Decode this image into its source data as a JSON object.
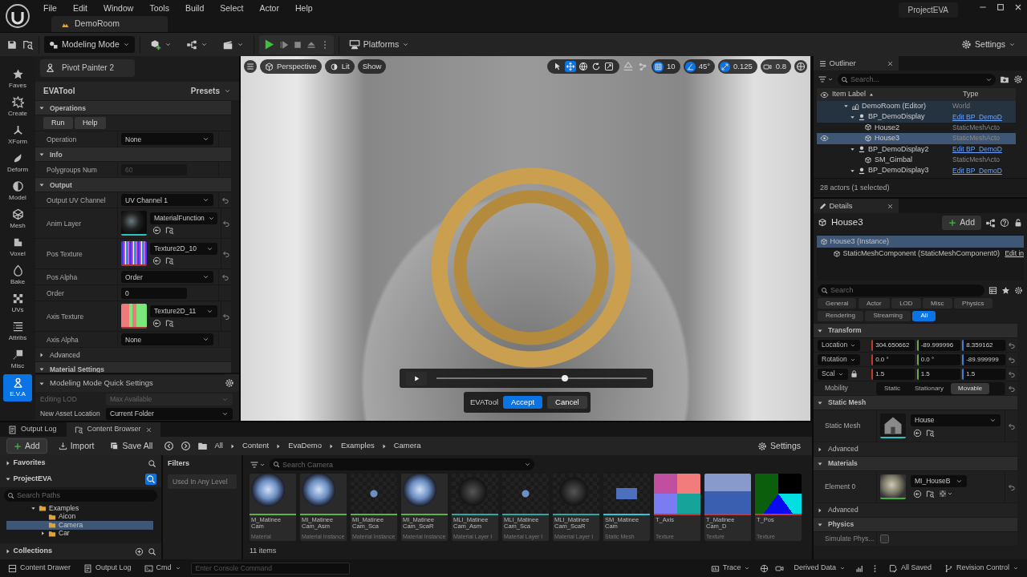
{
  "menu": [
    "File",
    "Edit",
    "Window",
    "Tools",
    "Build",
    "Select",
    "Actor",
    "Help"
  ],
  "project": "ProjectEVA",
  "level_tab": "DemoRoom",
  "toolbar": {
    "mode": "Modeling Mode",
    "platforms": "Platforms",
    "settings": "Settings"
  },
  "mode_palette": [
    {
      "label": "Faves",
      "kind": "star",
      "selected": false
    },
    {
      "label": "Create",
      "kind": "create",
      "selected": false
    },
    {
      "label": "XForm",
      "kind": "xform",
      "selected": false
    },
    {
      "label": "Deform",
      "kind": "deform",
      "selected": false
    },
    {
      "label": "Model",
      "kind": "model",
      "selected": false
    },
    {
      "label": "Mesh",
      "kind": "mesh",
      "selected": false
    },
    {
      "label": "Voxel",
      "kind": "voxel",
      "selected": false
    },
    {
      "label": "Bake",
      "kind": "bake",
      "selected": false
    },
    {
      "label": "UVs",
      "kind": "uvs",
      "selected": false
    },
    {
      "label": "Attribs",
      "kind": "attribs",
      "selected": false
    },
    {
      "label": "Misc",
      "kind": "misc",
      "selected": false
    },
    {
      "label": "E.V.A",
      "kind": "eva",
      "selected": true
    }
  ],
  "tool_panel": {
    "preset_button": "Pivot Painter 2",
    "title": "EVATool",
    "presets": "Presets",
    "sections": [
      {
        "title": "Operations",
        "kind": "category",
        "expanded": true,
        "rows": [
          {
            "kind": "buttons",
            "buttons": [
              "Run",
              "Help"
            ]
          },
          {
            "kind": "dropdown",
            "label": "Operation",
            "value": "None",
            "resettable": false
          }
        ]
      },
      {
        "title": "Info",
        "kind": "category",
        "expanded": true,
        "rows": [
          {
            "kind": "number",
            "label": "Polygroups Num",
            "value": "60",
            "disabled": true
          }
        ]
      },
      {
        "title": "Output",
        "kind": "category",
        "expanded": true,
        "rows": [
          {
            "kind": "dropdown",
            "label": "Output UV Channel",
            "value": "UV Channel 1",
            "resettable": true
          },
          {
            "kind": "asset",
            "label": "Anim Layer",
            "value": "MaterialFunction",
            "resettable": true
          },
          {
            "kind": "asset",
            "label": "Pos Texture",
            "value": "Texture2D_10",
            "resettable": true
          },
          {
            "kind": "dropdown",
            "label": "Pos Alpha",
            "value": "Order",
            "resettable": true
          },
          {
            "kind": "number",
            "label": "Order",
            "value": "0",
            "disabled": false
          },
          {
            "kind": "asset",
            "label": "Axis Texture",
            "value": "Texture2D_11",
            "resettable": true
          },
          {
            "kind": "dropdown",
            "label": "Axis Alpha",
            "value": "None",
            "resettable": false
          }
        ]
      },
      {
        "title": "Advanced",
        "kind": "group",
        "expanded": false
      },
      {
        "title": "Material Settings",
        "kind": "category",
        "expanded": true
      }
    ]
  },
  "quick_settings": {
    "title": "Modeling Mode Quick Settings",
    "rows": [
      {
        "label": "Editing LOD",
        "value": "Max Available",
        "disabled": true
      },
      {
        "label": "New Asset Location",
        "value": "Current Folder",
        "disabled": false
      }
    ]
  },
  "viewport": {
    "view_mode": "Perspective",
    "lighting": "Lit",
    "show": "Show",
    "transform_tools": [
      {
        "kind": "select",
        "selected": false
      },
      {
        "kind": "move",
        "selected": true
      },
      {
        "kind": "world",
        "selected": false
      },
      {
        "kind": "rotate",
        "selected": false
      },
      {
        "kind": "scale",
        "selected": false
      }
    ],
    "snaps": [
      {
        "kind": "grid",
        "value": "10",
        "on": true
      },
      {
        "kind": "angle",
        "value": "45°",
        "on": true
      },
      {
        "kind": "scale",
        "value": "0.125",
        "on": true
      },
      {
        "kind": "camera",
        "value": "0.8",
        "on": false
      }
    ],
    "playback": {
      "level": 0.61
    },
    "tool_overlay": {
      "label": "EVATool",
      "accept": "Accept",
      "cancel": "Cancel"
    }
  },
  "outliner": {
    "title": "Outliner",
    "search_placeholder": "Search...",
    "columns": [
      "Item Label",
      "Type"
    ],
    "items": [
      {
        "label": "DemoRoom (Editor)",
        "kind": "world",
        "type": "World",
        "type_link": false,
        "selected": false,
        "eye": false,
        "expanded": true,
        "children": [
          {
            "label": "BP_DemoDisplay",
            "kind": "blueprint",
            "type": "Edit BP_DemoD",
            "type_link": true,
            "selected": false,
            "eye": false,
            "expanded": true,
            "children": [
              {
                "label": "House2",
                "kind": "mesh",
                "type": "StaticMeshActo",
                "type_link": false,
                "selected": false,
                "eye": false
              },
              {
                "label": "House3",
                "kind": "mesh",
                "type": "StaticMeshActo",
                "type_link": false,
                "selected": true,
                "eye": true
              }
            ]
          },
          {
            "label": "BP_DemoDisplay2",
            "kind": "blueprint",
            "type": "Edit BP_DemoD",
            "type_link": true,
            "selected": false,
            "eye": false,
            "expanded": true,
            "children": [
              {
                "label": "SM_Gimbal",
                "kind": "mesh",
                "type": "StaticMeshActo",
                "type_link": false,
                "selected": false,
                "eye": false
              }
            ]
          },
          {
            "label": "BP_DemoDisplay3",
            "kind": "blueprint",
            "type": "Edit BP_DemoD",
            "type_link": true,
            "selected": false,
            "eye": false,
            "expanded": true
          }
        ]
      }
    ],
    "footer": "28 actors (1 selected)"
  },
  "details": {
    "title": "Details",
    "actor": "House3",
    "add": "Add",
    "components": [
      {
        "label": "House3 (Instance)",
        "selected": true
      },
      {
        "label": "StaticMeshComponent (StaticMeshComponent0)",
        "selected": false,
        "link": "Edit in"
      }
    ],
    "search_placeholder": "Search",
    "filters": [
      {
        "label": "General",
        "selected": false
      },
      {
        "label": "Actor",
        "selected": false
      },
      {
        "label": "LOD",
        "selected": false
      },
      {
        "label": "Misc",
        "selected": false
      },
      {
        "label": "Physics",
        "selected": false
      },
      {
        "label": "Rendering",
        "selected": false
      },
      {
        "label": "Streaming",
        "selected": false
      },
      {
        "label": "All",
        "selected": true
      }
    ],
    "sections": [
      {
        "title": "Transform",
        "kind": "category",
        "expanded": true,
        "rows": [
          {
            "kind": "vector",
            "label": "Location",
            "values": [
              "304.650662",
              "-89.999996",
              "8.359162"
            ],
            "locked": false
          },
          {
            "kind": "vector",
            "label": "Rotation",
            "values": [
              "0.0 °",
              "0.0 °",
              "-89.999999"
            ],
            "locked": false
          },
          {
            "kind": "vector",
            "label": "Scal",
            "values": [
              "1.5",
              "1.5",
              "1.5"
            ],
            "locked": true
          },
          {
            "kind": "segmented",
            "label": "Mobility",
            "options": [
              {
                "label": "Static",
                "selected": false
              },
              {
                "label": "Stationary",
                "selected": false
              },
              {
                "label": "Movable",
                "selected": true
              }
            ]
          }
        ]
      },
      {
        "title": "Static Mesh",
        "kind": "category",
        "expanded": true,
        "rows": [
          {
            "kind": "asset",
            "label": "Static Mesh",
            "value": "House",
            "material_options": false
          }
        ]
      },
      {
        "title": "Advanced",
        "kind": "group",
        "expanded": false
      },
      {
        "title": "Materials",
        "kind": "category",
        "expanded": true,
        "rows": [
          {
            "kind": "asset",
            "label": "Element 0",
            "value": "MI_HouseB",
            "material_options": true
          }
        ]
      },
      {
        "title": "Advanced",
        "kind": "group",
        "expanded": false
      },
      {
        "title": "Physics",
        "kind": "category",
        "expanded": true,
        "rows": [
          {
            "kind": "checkbox",
            "label": "Simulate Phys...",
            "checked": false,
            "disabled": true
          }
        ]
      }
    ]
  },
  "bottom_tabs": [
    {
      "label": "Output Log",
      "selected": false
    },
    {
      "label": "Content Browser",
      "selected": true
    }
  ],
  "content_browser": {
    "add": "Add",
    "import": "Import",
    "save_all": "Save All",
    "path": [
      "All",
      "Content",
      "EvaDemo",
      "Examples",
      "Camera"
    ],
    "settings": "Settings",
    "favorites": {
      "label": "Favorites",
      "expanded": false
    },
    "project": {
      "label": "ProjectEVA",
      "expanded": true
    },
    "path_search_placeholder": "Search Paths",
    "folders": [
      {
        "label": "Examples",
        "selected": false,
        "expanded": true,
        "children": [
          {
            "label": "Aicon",
            "selected": false
          },
          {
            "label": "Camera",
            "selected": true
          },
          {
            "label": "Car",
            "selected": false,
            "expanded": false
          }
        ]
      }
    ],
    "collections": {
      "label": "Collections",
      "expanded": false
    },
    "filters_title": "Filters",
    "filter_chips": [
      "Used In Any Level"
    ],
    "search_placeholder": "Search Camera",
    "assets": [
      {
        "name": "M_Matinee Cam",
        "type": "Material",
        "kind": "sphere",
        "color": "#5fb24a"
      },
      {
        "name": "MI_Matinee Cam_Asm",
        "type": "Material Instance",
        "kind": "sphere",
        "color": "#5fb24a"
      },
      {
        "name": "MI_Matinee Cam_Sca",
        "type": "Material Instance",
        "kind": "small",
        "color": "#5fb24a"
      },
      {
        "name": "MI_Matinee Cam_ScaR",
        "type": "Material Instance",
        "kind": "sphere",
        "color": "#5fb24a"
      },
      {
        "name": "MLI_Matinee Cam_Asm",
        "type": "Material Layer I",
        "kind": "dark",
        "color": "#2fa7a2"
      },
      {
        "name": "MLI_Matinee Cam_Sca",
        "type": "Material Layer I",
        "kind": "small",
        "color": "#2fa7a2"
      },
      {
        "name": "MLI_Matinee Cam_ScaR",
        "type": "Material Layer I",
        "kind": "dark",
        "color": "#2fa7a2"
      },
      {
        "name": "SM_Matinee Cam",
        "type": "Static Mesh",
        "kind": "camera",
        "color": "#37c4d8"
      },
      {
        "name": "T_Axis",
        "type": "Texture",
        "kind": "texture",
        "color": "#c23a3a"
      },
      {
        "name": "T_Matinee Cam_D",
        "type": "Texture",
        "kind": "texture2",
        "color": "#c23a3a"
      },
      {
        "name": "T_Pos",
        "type": "Texture",
        "kind": "texture3",
        "color": "#c23a3a"
      }
    ],
    "item_count": "11 items"
  },
  "status_bar": {
    "content_drawer": "Content Drawer",
    "output_log": "Output Log",
    "cmd": "Cmd",
    "console_placeholder": "Enter Console Command",
    "trace": "Trace",
    "derived_data": "Derived Data",
    "save_state": "All Saved",
    "revision_control": "Revision Control"
  }
}
